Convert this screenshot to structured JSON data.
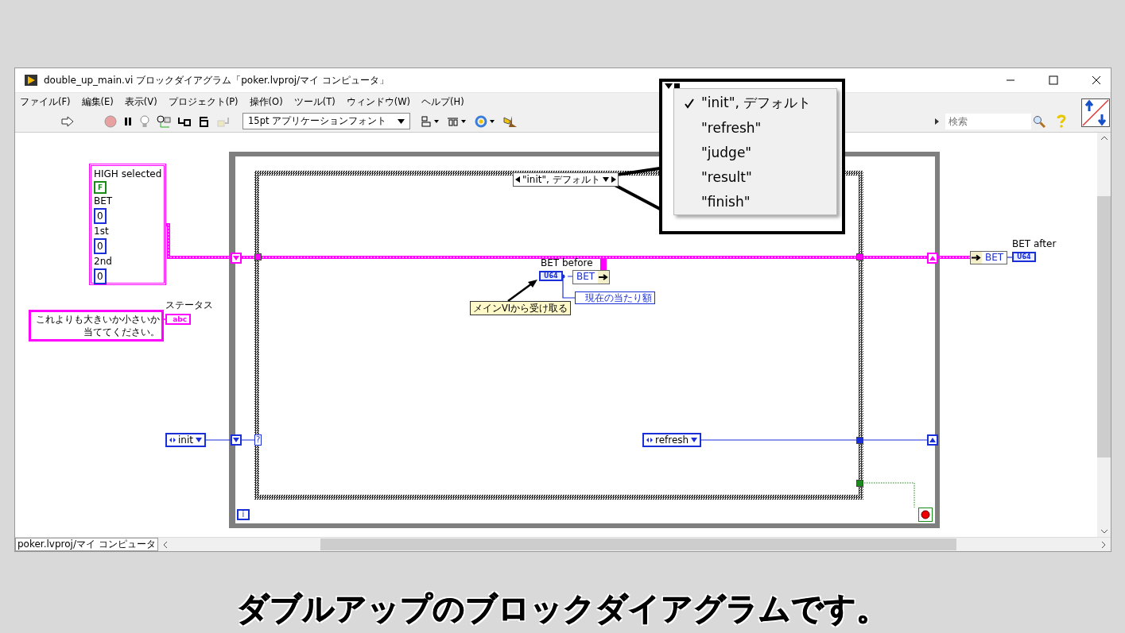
{
  "window": {
    "title": "double_up_main.vi ブロックダイアグラム「poker.lvproj/マイ コンピュータ」"
  },
  "menu": [
    "ファイル(F)",
    "編集(E)",
    "表示(V)",
    "プロジェクト(P)",
    "操作(O)",
    "ツール(T)",
    "ウィンドウ(W)",
    "ヘルプ(H)"
  ],
  "toolbar": {
    "font": "15pt アプリケーションフォント",
    "search_placeholder": "検索"
  },
  "diagram": {
    "cluster_constant": {
      "fields": [
        {
          "label": "HIGH selected",
          "kind": "boolean",
          "value": "F"
        },
        {
          "label": "BET",
          "kind": "numeric",
          "value": "0"
        },
        {
          "label": "1st",
          "kind": "numeric",
          "value": "0"
        },
        {
          "label": "2nd",
          "kind": "numeric",
          "value": "0"
        }
      ]
    },
    "status_constant": {
      "lines": [
        "これよりも大きいか小さいか",
        "当ててください。"
      ]
    },
    "status_indicator": {
      "label": "ステータス",
      "type": "abc"
    },
    "case_selector": "\"init\", デフォルト",
    "bet_before": {
      "label": "BET before",
      "type": "U64"
    },
    "unbundle_left": "BET",
    "property_node": "現在の当たり額",
    "comment": "メインVIから受け取る",
    "unbundle_right": "BET",
    "bet_after": {
      "label": "BET after",
      "type": "U64"
    },
    "enum_init": "init",
    "selector_tunnel": "?",
    "enum_refresh": "refresh",
    "iteration": "i"
  },
  "case_menu": {
    "items": [
      {
        "label": "\"init\", デフォルト",
        "selected": true
      },
      {
        "label": "\"refresh\"",
        "selected": false
      },
      {
        "label": "\"judge\"",
        "selected": false
      },
      {
        "label": "\"result\"",
        "selected": false
      },
      {
        "label": "\"finish\"",
        "selected": false
      }
    ]
  },
  "status_bar": "poker.lvproj/マイ コンピュータ",
  "caption": "ダブルアップのブロックダイアグラムです。"
}
